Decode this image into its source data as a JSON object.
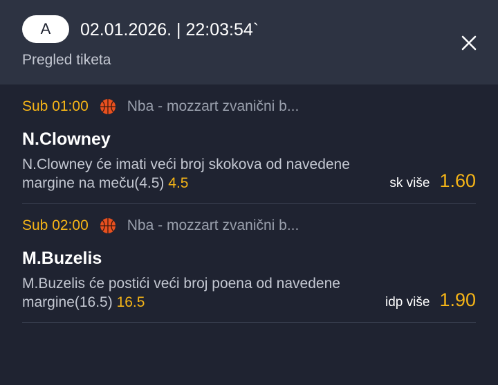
{
  "header": {
    "badge": "A",
    "datetime": "02.01.2026. | 22:03:54`",
    "subtitle": "Pregled tiketa"
  },
  "icons": {
    "close": "close-icon",
    "sport": "basketball-icon"
  },
  "colors": {
    "accent": "#f5b417",
    "header_bg": "#2d3342",
    "body_bg": "#1f2331"
  },
  "matches": [
    {
      "time": "Sub 01:00",
      "league": "Nba - mozzart zvanični b...",
      "player": "N.Clowney",
      "description": "N.Clowney će imati veći broj skokova od navedene margine na meču(4.5)",
      "line": "4.5",
      "market": "sk više",
      "odd": "1.60"
    },
    {
      "time": "Sub 02:00",
      "league": "Nba - mozzart zvanični b...",
      "player": "M.Buzelis",
      "description": "M.Buzelis će postići veći broj poena od navedene margine(16.5)",
      "line": "16.5",
      "market": "idp više",
      "odd": "1.90"
    }
  ]
}
